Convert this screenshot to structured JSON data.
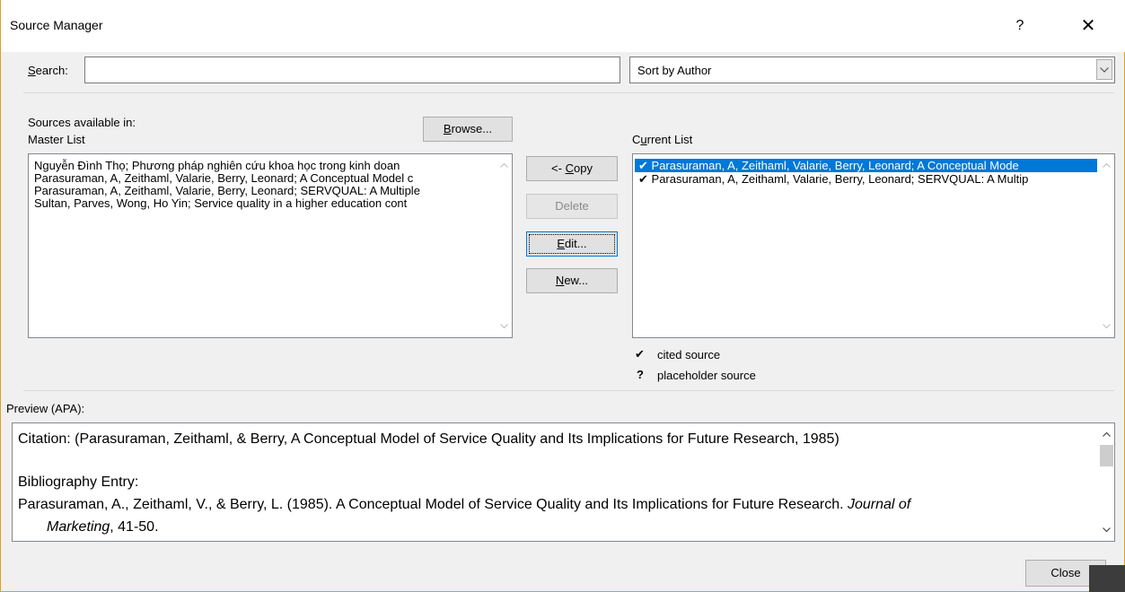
{
  "window": {
    "title": "Source Manager",
    "help": "?",
    "close": "✕"
  },
  "search": {
    "label_prefix": "",
    "label_accel": "S",
    "label_rest": "earch:",
    "value": ""
  },
  "sort": {
    "selected": "Sort by Author"
  },
  "master": {
    "sources_available": "Sources available in:",
    "list_label": "Master List",
    "browse_accel": "B",
    "browse_rest": "rowse...",
    "items": [
      "Nguyễn Đình Thọ; Phương pháp nghiên cứu khoa học trong kinh doan",
      "Parasuraman, A, Zeithaml, Valarie, Berry, Leonard; A Conceptual Model c",
      "Parasuraman, A, Zeithaml, Valarie, Berry, Leonard; SERVQUAL: A Multiple",
      "Sultan, Parves, Wong, Ho Yin; Service quality in a higher education cont"
    ]
  },
  "buttons": {
    "copy_prefix": "<- ",
    "copy_accel": "C",
    "copy_rest": "opy",
    "delete": "Delete",
    "edit_accel": "E",
    "edit_rest": "dit...",
    "new_accel": "N",
    "new_rest": "ew...",
    "close": "Close"
  },
  "current": {
    "label_prefix": "C",
    "label_accel": "u",
    "label_rest": "rrent List",
    "items": [
      {
        "mark": "✔",
        "text": "Parasuraman, A, Zeithaml, Valarie, Berry, Leonard; A Conceptual Mode"
      },
      {
        "mark": "✔",
        "text": "Parasuraman, A, Zeithaml, Valarie, Berry, Leonard; SERVQUAL: A Multip"
      }
    ]
  },
  "legend": {
    "cited_mark": "✔",
    "cited": "cited source",
    "placeholder_mark": "?",
    "placeholder": "placeholder source"
  },
  "preview": {
    "label": "Preview (APA):",
    "citation": "Citation:  (Parasuraman, Zeithaml, & Berry, A Conceptual Model of Service Quality and Its Implications for Future Research, 1985)",
    "bib_heading": "Bibliography Entry:",
    "bib_line1": "Parasuraman, A., Zeithaml, V., & Berry, L. (1985). A Conceptual Model of Service Quality and Its Implications for Future Research. ",
    "bib_journal1": "Journal of",
    "bib_journal2": "Marketing",
    "bib_tail": ", 41-50."
  }
}
